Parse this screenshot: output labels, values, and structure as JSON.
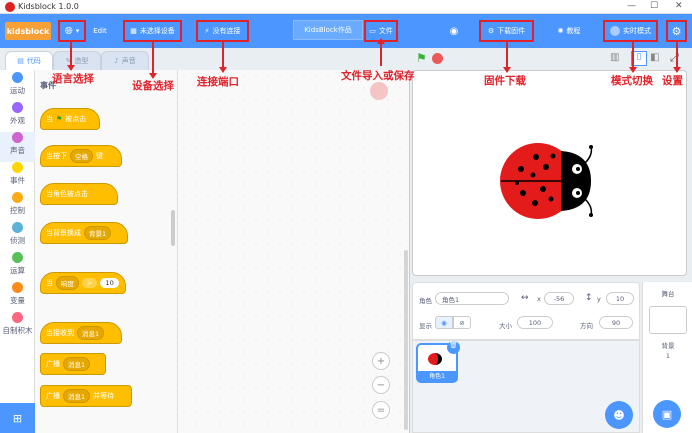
{
  "window": {
    "title": "Kidsblock 1.0.0",
    "minimize": "—",
    "maximize": "☐",
    "close": "✕"
  },
  "menubar": {
    "brand": "kidsblock",
    "edit": "Edit",
    "device_select": "未选择设备",
    "connect": "没有连接",
    "project_name": "KidsBlock作品",
    "file": "文件",
    "firmware": "下载固件",
    "tutorial": "教程",
    "mode": "实时模式"
  },
  "tabs": {
    "code": "代码",
    "costumes": "造型",
    "sounds": "声音"
  },
  "categories": [
    {
      "label": "运动",
      "color": "#4c97ff"
    },
    {
      "label": "外观",
      "color": "#9966ff"
    },
    {
      "label": "声音",
      "color": "#cf63cf"
    },
    {
      "label": "事件",
      "color": "#ffd500"
    },
    {
      "label": "控制",
      "color": "#ffab19"
    },
    {
      "label": "侦测",
      "color": "#5cb1d6"
    },
    {
      "label": "运算",
      "color": "#59c059"
    },
    {
      "label": "变量",
      "color": "#ff8c1a"
    },
    {
      "label": "自制积木",
      "color": "#ff6680"
    }
  ],
  "palette": {
    "section": "事件",
    "blocks": {
      "flag_when": "当",
      "flag_clicked": "被点击",
      "key_pressed": "当按下",
      "key_value": "空格",
      "key_suffix": "键",
      "sprite_clicked": "当角色被点击",
      "backdrop_switch": "当背景换成",
      "backdrop_value": "背景1",
      "when": "当",
      "loudness": "响度",
      "gt": ">",
      "gt_value": "10",
      "receive": "当接收到",
      "message1": "消息1",
      "broadcast": "广播",
      "broadcast_message": "消息1",
      "broadcast2": "广播",
      "broadcast2_message": "消息1",
      "and_wait": "并等待"
    }
  },
  "zoom": {
    "in": "+",
    "out": "−",
    "reset": "="
  },
  "sprite_info": {
    "sprite_label": "角色",
    "sprite_name": "角色1",
    "x_label": "x",
    "x_value": "-56",
    "y_label": "y",
    "y_value": "10",
    "show_label": "显示",
    "size_label": "大小",
    "size_value": "100",
    "direction_label": "方向",
    "direction_value": "90"
  },
  "sprite_list": {
    "thumb_label": "角色1"
  },
  "stage_panel": {
    "header": "舞台",
    "backdrop_label": "背景",
    "backdrop_count": "1"
  },
  "annotations": {
    "language": "语言选择",
    "device": "设备选择",
    "connect": "连接端口",
    "file": "文件导入或保存",
    "firmware": "固件下载",
    "mode": "模式切换",
    "settings": "设置"
  },
  "colors": {
    "accent": "#4c97ff",
    "annotation": "#e0232b",
    "event": "#ffbf00",
    "brand": "#f7a035"
  }
}
